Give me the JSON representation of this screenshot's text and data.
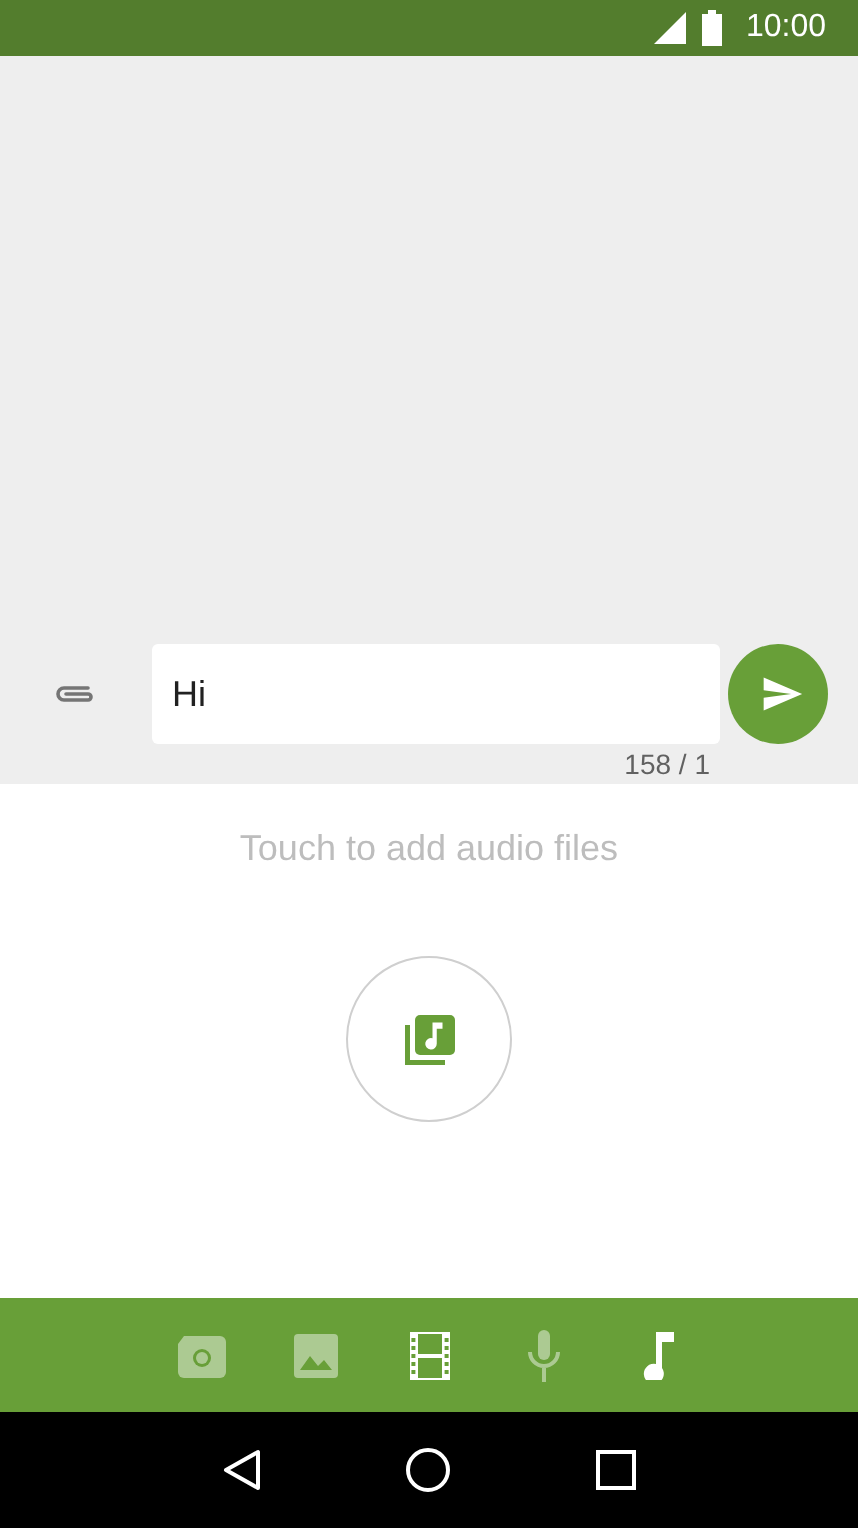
{
  "status_bar": {
    "time": "10:00"
  },
  "composer": {
    "value": "Hi",
    "counter": "158 / 1"
  },
  "audio_panel": {
    "hint": "Touch to add audio files"
  },
  "attach_tabs": [
    {
      "kind": "camera",
      "active": false
    },
    {
      "kind": "image",
      "active": false
    },
    {
      "kind": "video",
      "active": true
    },
    {
      "kind": "mic",
      "active": false
    },
    {
      "kind": "music",
      "active": true
    }
  ]
}
